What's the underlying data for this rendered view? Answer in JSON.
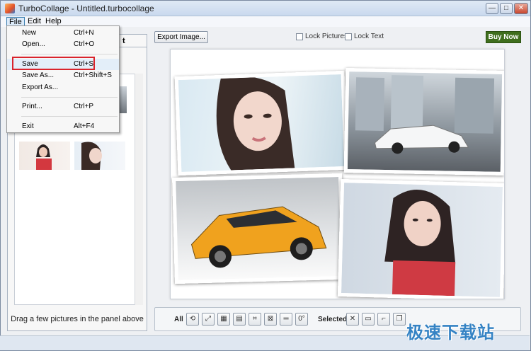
{
  "window": {
    "title": "TurboCollage - Untitled.turbocollage",
    "minimize": "—",
    "maximize": "□",
    "close": "✕"
  },
  "menubar": [
    "File",
    "Edit",
    "Help"
  ],
  "file_menu": [
    {
      "label": "New",
      "shortcut": "Ctrl+N"
    },
    {
      "label": "Open...",
      "shortcut": "Ctrl+O"
    },
    {
      "label": "Save",
      "shortcut": "Ctrl+S"
    },
    {
      "label": "Save As...",
      "shortcut": "Ctrl+Shift+S"
    },
    {
      "label": "Export As...",
      "shortcut": ""
    },
    {
      "label": "Print...",
      "shortcut": "Ctrl+P"
    },
    {
      "label": "Exit",
      "shortcut": "Alt+F4"
    }
  ],
  "left_panel": {
    "tab_fragment": "t",
    "hint": "Drag a few pictures in the panel above"
  },
  "toolbar": {
    "export_image": "Export Image...",
    "lock_pictures": "Lock Pictures",
    "lock_text": "Lock Text",
    "buy_now": "Buy Now"
  },
  "bottom_toolbar": {
    "all_label": "All",
    "selected_label": "Selected",
    "rotate_value": "0°"
  },
  "watermark": "极速下载站",
  "colors": {
    "accent": "#3f6e1d",
    "highlight": "#d9232c",
    "watermark": "#3583c4"
  }
}
